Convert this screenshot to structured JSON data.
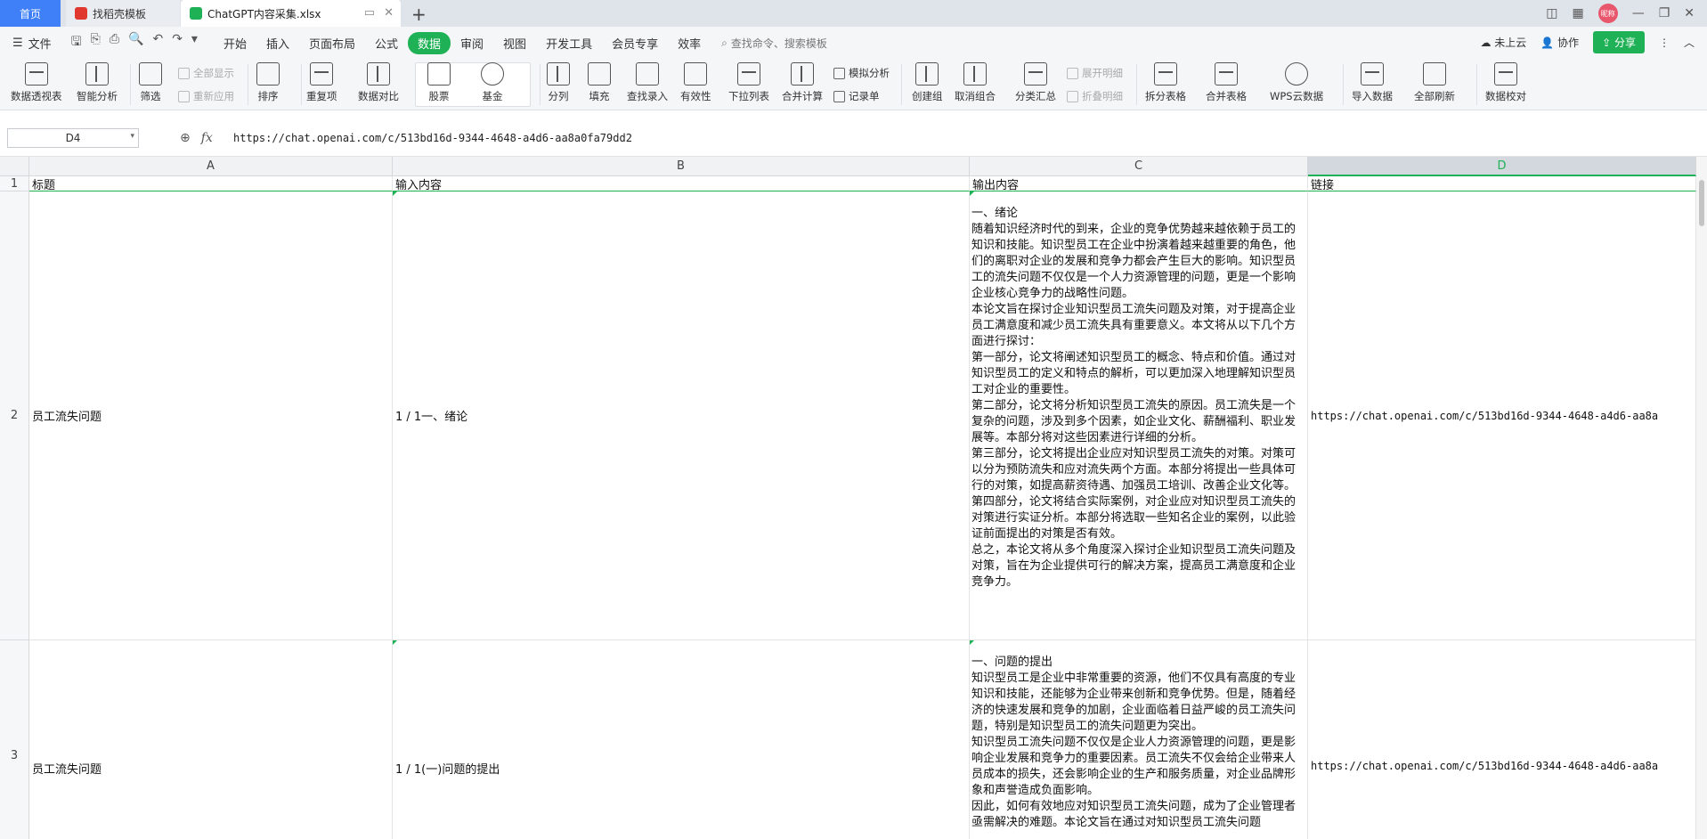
{
  "tabs": {
    "home": "首页",
    "template": "找稻壳模板",
    "file": "ChatGPT内容采集.xlsx"
  },
  "account": {
    "avatar_text": "昵称"
  },
  "menu": {
    "file": "文件",
    "tabs": [
      "开始",
      "插入",
      "页面布局",
      "公式",
      "数据",
      "审阅",
      "视图",
      "开发工具",
      "会员专享",
      "效率"
    ],
    "search_placeholder": "查找命令、搜索模板",
    "cloud": "未上云",
    "collab": "协作",
    "share": "分享"
  },
  "ribbon": {
    "pivot": "数据透视表",
    "smart": "智能分析",
    "filter": "筛选",
    "show_all": "全部显示",
    "reapply": "重新应用",
    "sort": "排序",
    "dup": "重复项",
    "compare": "数据对比",
    "stock": "股票",
    "fund": "基金",
    "split": "分列",
    "fill": "填充",
    "lookup": "查找录入",
    "valid": "有效性",
    "dropdown": "下拉列表",
    "merge_calc": "合并计算",
    "simulate": "模拟分析",
    "record": "记录单",
    "group": "创建组",
    "ungroup": "取消组合",
    "subtotal": "分类汇总",
    "expand": "展开明细",
    "collapse": "折叠明细",
    "split_table": "拆分表格",
    "merge_table": "合并表格",
    "wps_cloud": "WPS云数据",
    "import": "导入数据",
    "refresh": "全部刷新",
    "proof": "数据校对"
  },
  "formula_bar": {
    "cell_ref": "D4",
    "content": "https://chat.openai.com/c/513bd16d-9344-4648-a4d6-aa8a0fa79dd2"
  },
  "sheet": {
    "columns": [
      "A",
      "B",
      "C",
      "D"
    ],
    "rows": [
      {
        "num": "1",
        "a": "标题",
        "b": "输入内容",
        "c": "输出内容",
        "d": "链接"
      },
      {
        "num": "2",
        "a": "员工流失问题",
        "b": "1 / 1一、绪论",
        "c": "一、绪论\n随着知识经济时代的到来，企业的竞争优势越来越依赖于员工的知识和技能。知识型员工在企业中扮演着越来越重要的角色，他们的离职对企业的发展和竞争力都会产生巨大的影响。知识型员工的流失问题不仅仅是一个人力资源管理的问题，更是一个影响企业核心竞争力的战略性问题。\n本论文旨在探讨企业知识型员工流失问题及对策，对于提高企业员工满意度和减少员工流失具有重要意义。本文将从以下几个方面进行探讨：\n第一部分，论文将阐述知识型员工的概念、特点和价值。通过对知识型员工的定义和特点的解析，可以更加深入地理解知识型员工对企业的重要性。\n第二部分，论文将分析知识型员工流失的原因。员工流失是一个复杂的问题，涉及到多个因素，如企业文化、薪酬福利、职业发展等。本部分将对这些因素进行详细的分析。\n第三部分，论文将提出企业应对知识型员工流失的对策。对策可以分为预防流失和应对流失两个方面。本部分将提出一些具体可行的对策，如提高薪资待遇、加强员工培训、改善企业文化等。\n第四部分，论文将结合实际案例，对企业应对知识型员工流失的对策进行实证分析。本部分将选取一些知名企业的案例，以此验证前面提出的对策是否有效。\n总之，本论文将从多个角度深入探讨企业知识型员工流失问题及对策，旨在为企业提供可行的解决方案，提高员工满意度和企业竞争力。",
        "d": "https://chat.openai.com/c/513bd16d-9344-4648-a4d6-aa8a"
      },
      {
        "num": "3",
        "a": "员工流失问题",
        "b": "1 / 1(一)问题的提出",
        "c": "一、问题的提出\n知识型员工是企业中非常重要的资源，他们不仅具有高度的专业知识和技能，还能够为企业带来创新和竞争优势。但是，随着经济的快速发展和竞争的加剧，企业面临着日益严峻的员工流失问题，特别是知识型员工的流失问题更为突出。\n知识型员工流失问题不仅仅是企业人力资源管理的问题，更是影响企业发展和竞争力的重要因素。员工流失不仅会给企业带来人员成本的损失，还会影响企业的生产和服务质量，对企业品牌形象和声誉造成负面影响。\n因此，如何有效地应对知识型员工流失问题，成为了企业管理者亟需解决的难题。本论文旨在通过对知识型员工流失问题",
        "d": "https://chat.openai.com/c/513bd16d-9344-4648-a4d6-aa8a"
      }
    ]
  }
}
